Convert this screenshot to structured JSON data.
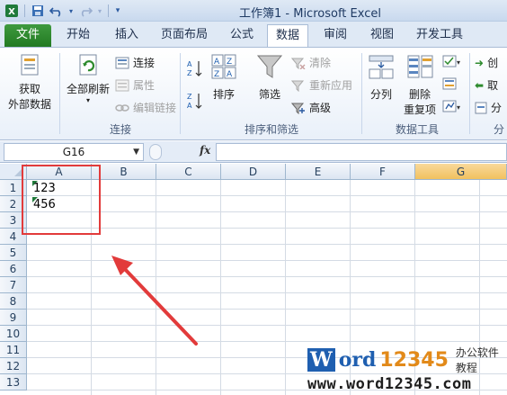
{
  "window": {
    "title": "工作簿1 - Microsoft Excel"
  },
  "tabs": [
    {
      "label": "文件"
    },
    {
      "label": "开始"
    },
    {
      "label": "插入"
    },
    {
      "label": "页面布局"
    },
    {
      "label": "公式"
    },
    {
      "label": "数据"
    },
    {
      "label": "审阅"
    },
    {
      "label": "视图"
    },
    {
      "label": "开发工具"
    }
  ],
  "ribbon": {
    "get_external": {
      "line1": "获取",
      "line2": "外部数据"
    },
    "refresh_all": "全部刷新",
    "connections": "连接",
    "properties": "属性",
    "edit_links": "编辑链接",
    "group_connections": "连接",
    "sort": "排序",
    "filter": "筛选",
    "clear": "清除",
    "reapply": "重新应用",
    "advanced": "高级",
    "group_sort": "排序和筛选",
    "text_to_columns": "分列",
    "remove_dup": {
      "line1": "删除",
      "line2": "重复项"
    },
    "group_data_tools": "数据工具",
    "create": "创",
    "cancel": "取",
    "split": "分",
    "group_outline": "分"
  },
  "formula_bar": {
    "name_box": "G16",
    "fx": "fx",
    "formula": ""
  },
  "grid": {
    "columns": [
      "A",
      "B",
      "C",
      "D",
      "E",
      "F",
      "G"
    ],
    "rows": [
      "1",
      "2",
      "3",
      "4",
      "5",
      "6",
      "7",
      "8",
      "9",
      "10",
      "11",
      "12",
      "13"
    ],
    "cells": {
      "A1": "123",
      "A2": "456"
    },
    "selected_column": "G"
  },
  "watermark": {
    "brand": "Word",
    "brand_first": "W",
    "brand_rest": "ord",
    "digits": "12345",
    "tagline": "办公软件教程",
    "url": "www.word12345.com"
  },
  "colors": {
    "file_tab": "#2e8b2e",
    "highlight": "#e23b3b",
    "arrow": "#e23b3b",
    "header_selected": "#f1c15f"
  }
}
